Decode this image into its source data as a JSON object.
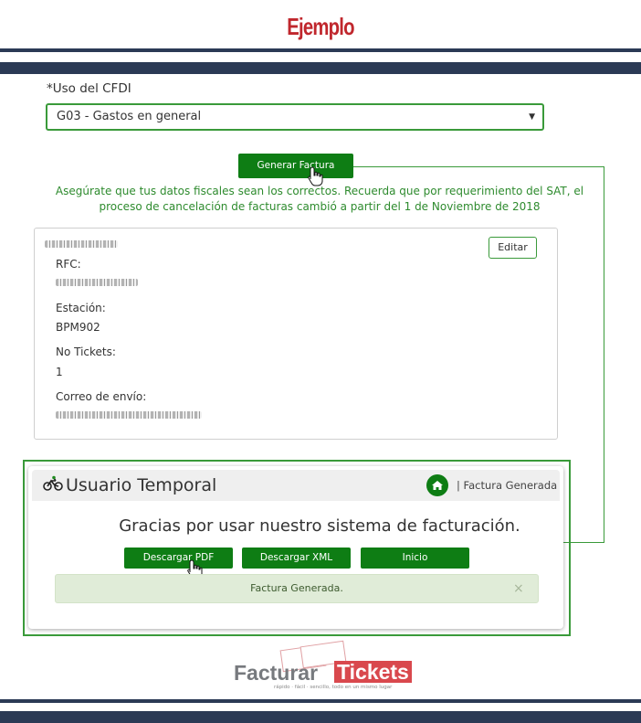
{
  "header": {
    "title": "Ejemplo"
  },
  "form": {
    "uso_label": "*Uso del CFDI",
    "uso_value": "G03 - Gastos en general",
    "generate_label": "Generar Factura",
    "note_line1": "Asegúrate que tus datos fiscales sean los correctos. Recuerda que por requerimiento del SAT, el",
    "note_line2": "proceso de cancelación de facturas cambió a partir del 1 de Noviembre de 2018"
  },
  "summary": {
    "edit_label": "Editar",
    "rfc_label": "RFC:",
    "station_label": "Estación:",
    "station_value": "BPM902",
    "tickets_label": "No Tickets:",
    "tickets_value": "1",
    "email_label": "Correo de envío:"
  },
  "result": {
    "title": "Usuario Temporal",
    "breadcrumb": "| Factura Generada",
    "message": "Gracias por usar nuestro sistema de facturación.",
    "buttons": [
      "Descargar PDF",
      "Descargar XML",
      "Inicio"
    ],
    "alert": "Factura Generada.",
    "alert_close": "×"
  },
  "logo": {
    "facturar": "Facturar",
    "tickets": "Tickets",
    "tagline": "rápido · fácil · sencillo, todo en un mismo lugar"
  },
  "colors": {
    "accent": "#0e7d14",
    "title_red": "#c0272d",
    "bars": "#2b3a55",
    "logo_red": "#d9484d"
  },
  "icons": {
    "bike": "bicycle-icon",
    "home": "home-icon",
    "cursor": "hand-cursor-icon"
  }
}
